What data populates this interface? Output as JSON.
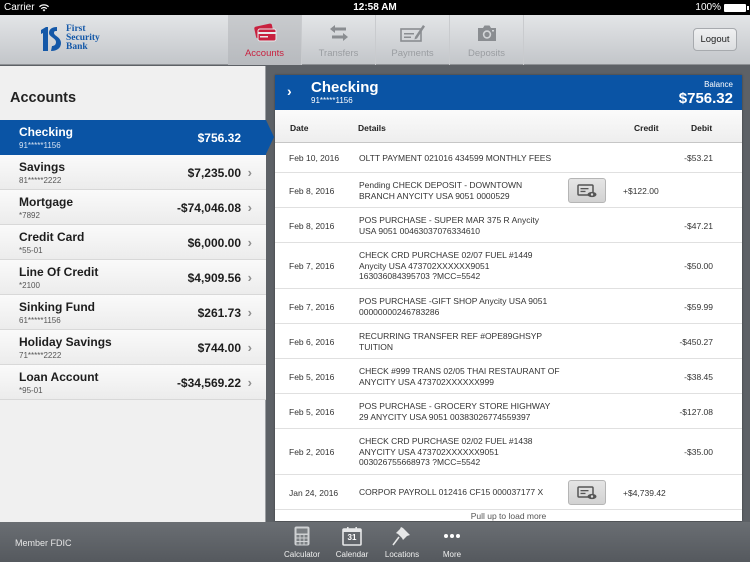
{
  "status_bar": {
    "carrier": "Carrier",
    "time": "12:58 AM",
    "battery": "100%"
  },
  "header": {
    "bank_name_line1": "First",
    "bank_name_line2": "Security",
    "bank_name_line3": "Bank",
    "tabs": [
      {
        "label": "Accounts",
        "icon": "credit-cards-icon",
        "active": true
      },
      {
        "label": "Transfers",
        "icon": "transfer-arrows-icon",
        "active": false
      },
      {
        "label": "Payments",
        "icon": "check-pen-icon",
        "active": false
      },
      {
        "label": "Deposits",
        "icon": "camera-icon",
        "active": false
      }
    ],
    "logout_label": "Logout",
    "active_color": "#c8213f"
  },
  "sidebar": {
    "title": "Accounts",
    "accounts": [
      {
        "name": "Checking",
        "number": "91*****1156",
        "balance": "$756.32",
        "selected": true
      },
      {
        "name": "Savings",
        "number": "81*****2222",
        "balance": "$7,235.00",
        "selected": false
      },
      {
        "name": "Mortgage",
        "number": "*7892",
        "balance": "-$74,046.08",
        "selected": false
      },
      {
        "name": "Credit Card",
        "number": "*55-01",
        "balance": "$6,000.00",
        "selected": false
      },
      {
        "name": "Line Of Credit",
        "number": "*2100",
        "balance": "$4,909.56",
        "selected": false
      },
      {
        "name": "Sinking Fund",
        "number": "61*****1156",
        "balance": "$261.73",
        "selected": false
      },
      {
        "name": "Holiday Savings",
        "number": "71*****2222",
        "balance": "$744.00",
        "selected": false
      },
      {
        "name": "Loan Account",
        "number": "*95-01",
        "balance": "-$34,569.22",
        "selected": false
      }
    ],
    "chevron": "›"
  },
  "detail": {
    "account_name": "Checking",
    "account_number": "91*****1156",
    "balance_label": "Balance",
    "balance_value": "$756.32",
    "brand_color": "#0a54a5",
    "columns": {
      "date": "Date",
      "details": "Details",
      "credit": "Credit",
      "debit": "Debit"
    },
    "transactions": [
      {
        "date": "Feb 10, 2016",
        "details": [
          "OLTT PAYMENT 021016 434599 MONTHLY FEES"
        ],
        "credit": "",
        "debit": "-$53.21",
        "has_image": false
      },
      {
        "date": "Feb 8, 2016",
        "details": [
          "Pending CHECK DEPOSIT - DOWNTOWN",
          "BRANCH ANYCITY USA 9051 0000529"
        ],
        "credit": "+$122.00",
        "debit": "",
        "has_image": true
      },
      {
        "date": "Feb 8, 2016",
        "details": [
          "POS PURCHASE -  SUPER MAR 375 R Anycity",
          "USA 9051 00463037076334610"
        ],
        "credit": "",
        "debit": "-$47.21",
        "has_image": false
      },
      {
        "date": "Feb 7, 2016",
        "details": [
          "CHECK CRD PURCHASE 02/07  FUEL #1449",
          "Anycity USA 473702XXXXXX9051",
          "163036084395703 ?MCC=5542"
        ],
        "credit": "",
        "debit": "-$50.00",
        "has_image": false
      },
      {
        "date": "Feb 7, 2016",
        "details": [
          "POS PURCHASE -GIFT SHOP Anycity USA 9051",
          "00000000246783286"
        ],
        "credit": "",
        "debit": "-$59.99",
        "has_image": false
      },
      {
        "date": "Feb 6, 2016",
        "details": [
          "RECURRING TRANSFER REF #OPE89GHSYP",
          "TUITION"
        ],
        "credit": "",
        "debit": "-$450.27",
        "has_image": false
      },
      {
        "date": "Feb 5, 2016",
        "details": [
          "CHECK #999 TRANS 02/05 THAI RESTAURANT OF",
          "ANYCITY USA 473702XXXXXX999"
        ],
        "credit": "",
        "debit": "-$38.45",
        "has_image": false
      },
      {
        "date": "Feb 5, 2016",
        "details": [
          "POS PURCHASE - GROCERY STORE HIGHWAY",
          "29 ANYCITY USA 9051 00383026774559397"
        ],
        "credit": "",
        "debit": "-$127.08",
        "has_image": false
      },
      {
        "date": "Feb 2, 2016",
        "details": [
          "CHECK CRD PURCHASE 02/02 FUEL #1438",
          "ANYCITY USA 473702XXXXXX9051",
          "003026755668973 ?MCC=5542"
        ],
        "credit": "",
        "debit": "-$35.00",
        "has_image": false
      },
      {
        "date": "Jan 24, 2016",
        "details": [
          "CORPOR PAYROLL 012416 CF15 000037177 X"
        ],
        "credit": "+$4,739.42",
        "debit": "",
        "has_image": true
      }
    ],
    "load_more": "Pull up to load more"
  },
  "footer": {
    "fdic": "Member FDIC",
    "tools": [
      {
        "label": "Calculator",
        "icon": "calculator-icon"
      },
      {
        "label": "Calendar",
        "icon": "calendar-icon",
        "day": "31"
      },
      {
        "label": "Locations",
        "icon": "pushpin-icon"
      },
      {
        "label": "More",
        "icon": "more-dots-icon"
      }
    ]
  }
}
